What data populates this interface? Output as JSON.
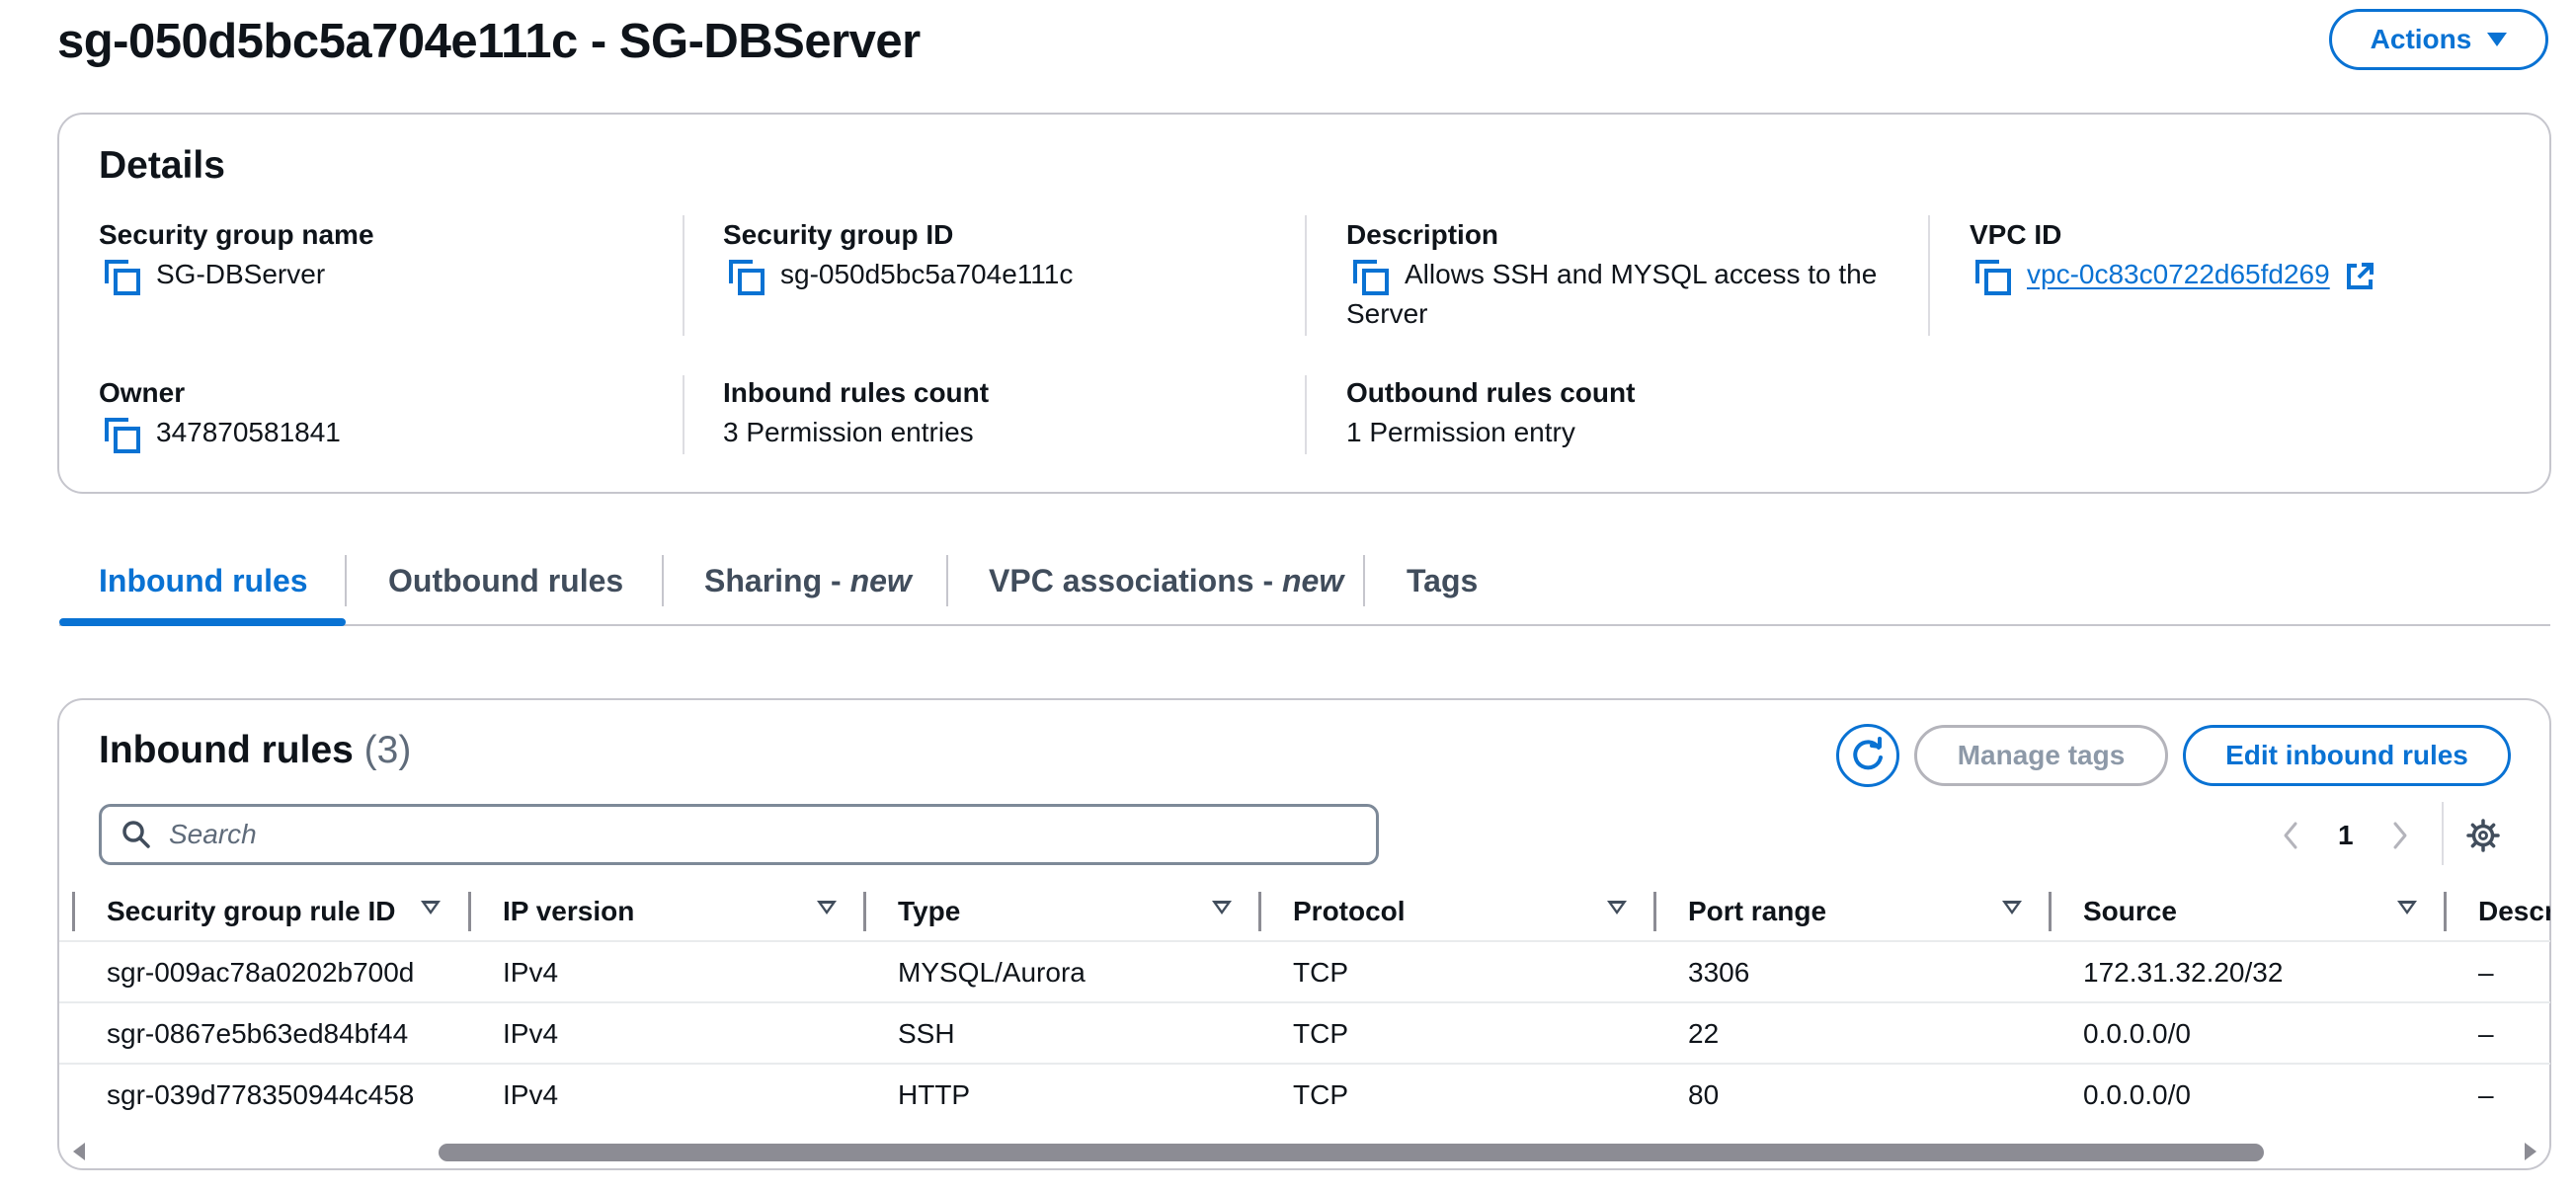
{
  "header": {
    "title": "sg-050d5bc5a704e111c - SG-DBServer",
    "actions_label": "Actions"
  },
  "details": {
    "heading": "Details",
    "security_group_name": {
      "label": "Security group name",
      "value": "SG-DBServer"
    },
    "security_group_id": {
      "label": "Security group ID",
      "value": "sg-050d5bc5a704e111c"
    },
    "description": {
      "label": "Description",
      "value": "Allows SSH and MYSQL access to the Server"
    },
    "vpc_id": {
      "label": "VPC ID",
      "value": "vpc-0c83c0722d65fd269"
    },
    "owner": {
      "label": "Owner",
      "value": "347870581841"
    },
    "inbound_count": {
      "label": "Inbound rules count",
      "value": "3 Permission entries"
    },
    "outbound_count": {
      "label": "Outbound rules count",
      "value": "1 Permission entry"
    }
  },
  "tabs": [
    {
      "label": "Inbound rules",
      "suffix": "",
      "active": true
    },
    {
      "label": "Outbound rules",
      "suffix": "",
      "active": false
    },
    {
      "label": "Sharing - ",
      "suffix": "new",
      "active": false
    },
    {
      "label": "VPC associations - ",
      "suffix": "new",
      "active": false
    },
    {
      "label": "Tags",
      "suffix": "",
      "active": false
    }
  ],
  "rules": {
    "title": "Inbound rules",
    "count": "(3)",
    "manage_tags_label": "Manage tags",
    "edit_label": "Edit inbound rules",
    "search_placeholder": "Search",
    "page": "1",
    "columns": [
      "Security group rule ID",
      "IP version",
      "Type",
      "Protocol",
      "Port range",
      "Source",
      "Descr"
    ],
    "rows": [
      [
        "sgr-009ac78a0202b700d",
        "IPv4",
        "MYSQL/Aurora",
        "TCP",
        "3306",
        "172.31.32.20/32",
        "–"
      ],
      [
        "sgr-0867e5b63ed84bf44",
        "IPv4",
        "SSH",
        "TCP",
        "22",
        "0.0.0.0/0",
        "–"
      ],
      [
        "sgr-039d778350944c458",
        "IPv4",
        "HTTP",
        "TCP",
        "80",
        "0.0.0.0/0",
        "–"
      ]
    ]
  },
  "colors": {
    "accent": "#0972d3",
    "text": "#0f141a",
    "border": "#c6c6cd",
    "disabled": "#8d99a8"
  },
  "icons": [
    "copy-icon",
    "external-link-icon",
    "caret-down-icon",
    "refresh-icon",
    "search-icon",
    "chevron-left-icon",
    "chevron-right-icon",
    "settings-gear-icon",
    "sort-icon"
  ]
}
